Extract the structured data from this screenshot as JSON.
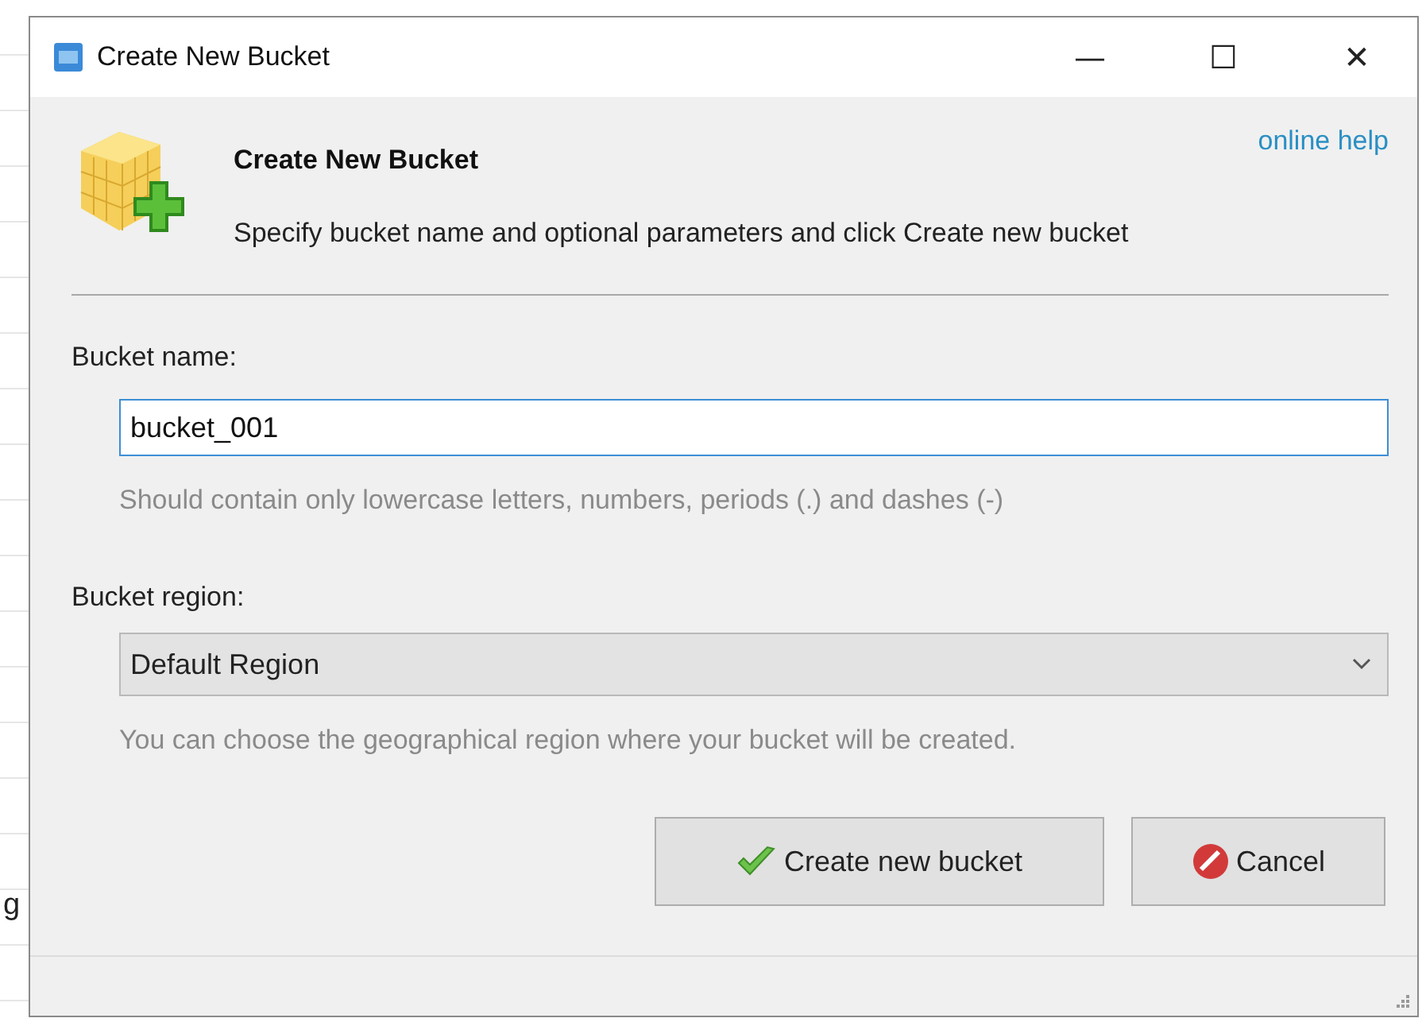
{
  "background_app": {
    "text": "g"
  },
  "window": {
    "title": "Create New Bucket",
    "controls": [
      "—",
      "☐",
      "✕"
    ]
  },
  "header": {
    "title": "Create New Bucket",
    "description": "Specify bucket name and optional parameters and click Create new bucket",
    "help_link": "online help"
  },
  "bucket_name": {
    "label": "Bucket name:",
    "value": "bucket_001",
    "hint": "Should contain only lowercase letters, numbers, periods (.) and dashes (-)"
  },
  "bucket_region": {
    "label": "Bucket region:",
    "value": "Default Region",
    "hint": "You can choose the geographical region where your bucket will be created."
  },
  "buttons": [
    {
      "label": "Create new bucket",
      "kind": "confirm"
    },
    {
      "label": "Cancel",
      "kind": "cancel"
    }
  ]
}
